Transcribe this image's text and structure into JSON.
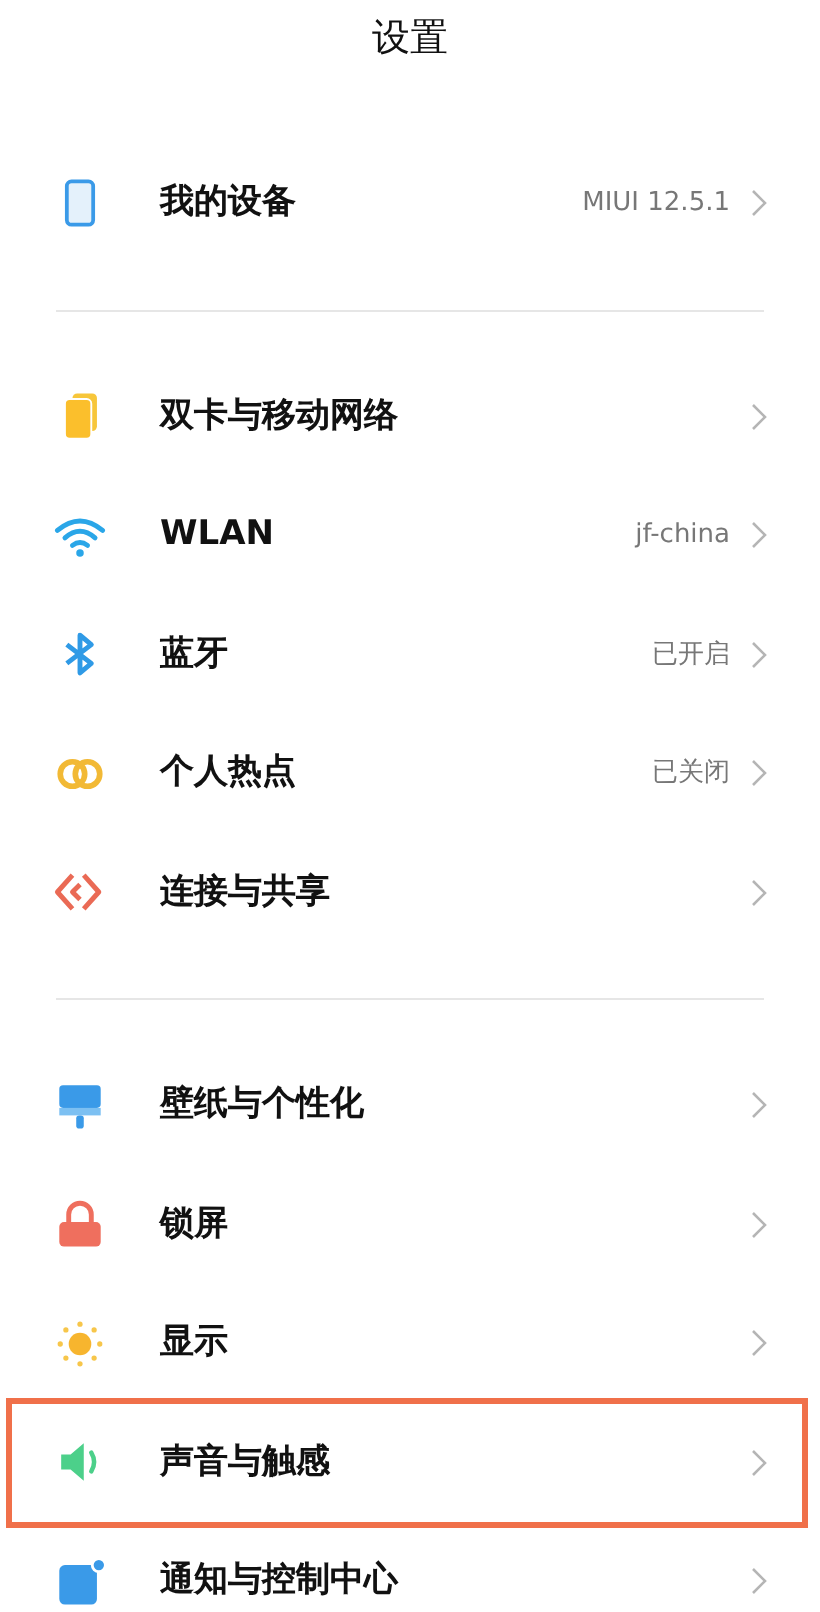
{
  "title": "设置",
  "sections": [
    {
      "items": [
        {
          "kind": "device",
          "label": "我的设备",
          "value": "MIUI 12.5.1",
          "highlighted": false
        }
      ]
    },
    {
      "items": [
        {
          "kind": "sim",
          "label": "双卡与移动网络",
          "highlighted": false
        },
        {
          "kind": "wifi",
          "label": "WLAN",
          "value": "jf-china",
          "highlighted": false
        },
        {
          "kind": "bluetooth",
          "label": "蓝牙",
          "value": "已开启",
          "highlighted": false
        },
        {
          "kind": "hotspot",
          "label": "个人热点",
          "value": "已关闭",
          "highlighted": false
        },
        {
          "kind": "share",
          "label": "连接与共享",
          "highlighted": false
        }
      ]
    },
    {
      "items": [
        {
          "kind": "wallpaper",
          "label": "壁纸与个性化",
          "highlighted": false
        },
        {
          "kind": "lock",
          "label": "锁屏",
          "highlighted": false
        },
        {
          "kind": "display",
          "label": "显示",
          "highlighted": false
        },
        {
          "kind": "sound",
          "label": "声音与触感",
          "highlighted": true
        },
        {
          "kind": "notification",
          "label": "通知与控制中心",
          "highlighted": false
        }
      ]
    }
  ]
}
